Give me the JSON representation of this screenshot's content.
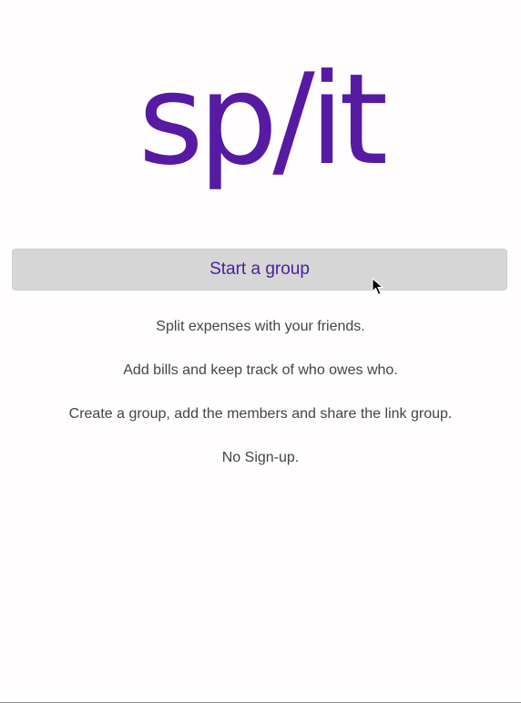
{
  "brand": {
    "logo_text": "sp/it",
    "logo_color": "#571aa3"
  },
  "hero": {
    "start_button_label": "Start a group",
    "button_background": "#d6d6d6",
    "button_text_color": "#4a1e9c"
  },
  "info": {
    "lines": [
      "Split expenses with your friends.",
      "Add bills and keep track of who owes who.",
      "Create a group, add the members and share the link group.",
      "No Sign-up."
    ]
  },
  "icons": {
    "cursor": "mouse-pointer-icon"
  }
}
